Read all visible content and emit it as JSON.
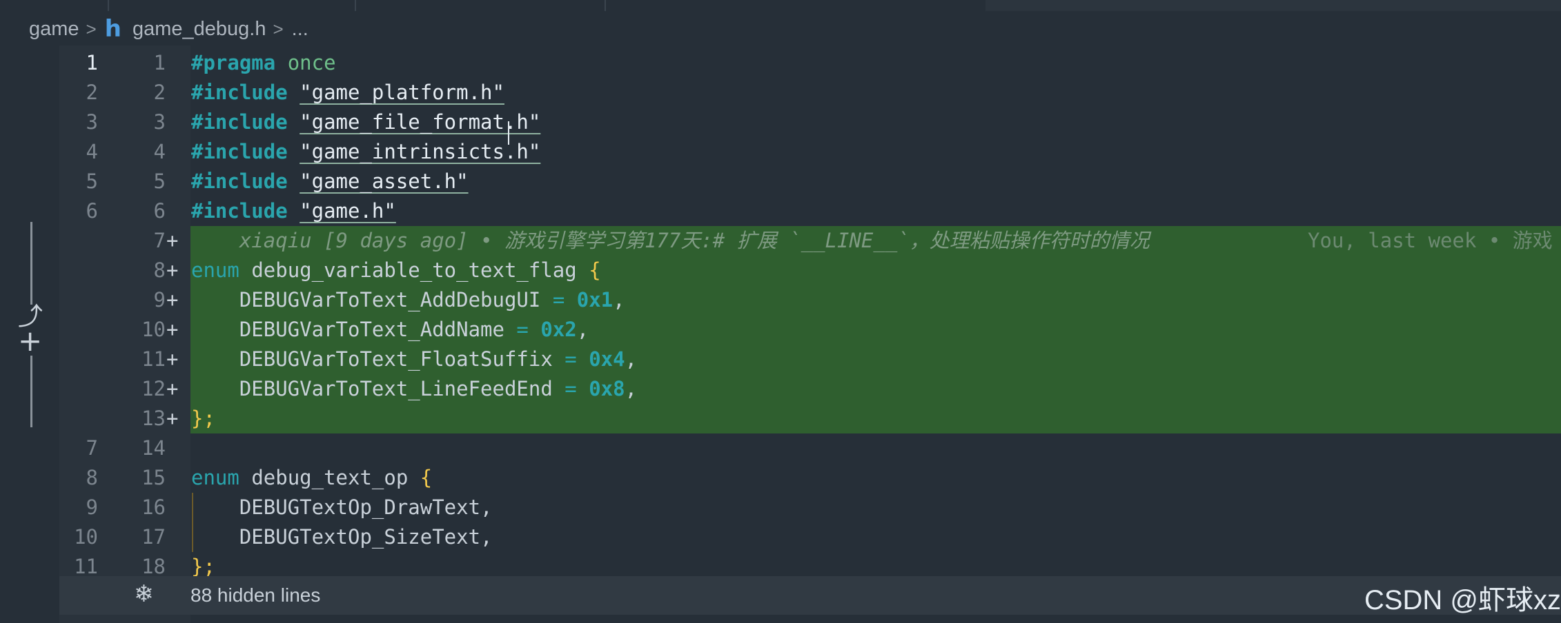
{
  "breadcrumb": {
    "folder": "game",
    "file": "game_debug.h",
    "more": "..."
  },
  "lines": [
    {
      "old": "1",
      "new": "1",
      "plus": "",
      "active": true
    },
    {
      "old": "2",
      "new": "2",
      "plus": ""
    },
    {
      "old": "3",
      "new": "3",
      "plus": ""
    },
    {
      "old": "4",
      "new": "4",
      "plus": ""
    },
    {
      "old": "5",
      "new": "5",
      "plus": ""
    },
    {
      "old": "6",
      "new": "6",
      "plus": ""
    },
    {
      "old": "",
      "new": "7",
      "plus": "+"
    },
    {
      "old": "",
      "new": "8",
      "plus": "+"
    },
    {
      "old": "",
      "new": "9",
      "plus": "+"
    },
    {
      "old": "",
      "new": "10",
      "plus": "+"
    },
    {
      "old": "",
      "new": "11",
      "plus": "+"
    },
    {
      "old": "",
      "new": "12",
      "plus": "+"
    },
    {
      "old": "",
      "new": "13",
      "plus": "+"
    },
    {
      "old": "7",
      "new": "14",
      "plus": ""
    },
    {
      "old": "8",
      "new": "15",
      "plus": ""
    },
    {
      "old": "9",
      "new": "16",
      "plus": ""
    },
    {
      "old": "10",
      "new": "17",
      "plus": ""
    },
    {
      "old": "11",
      "new": "18",
      "plus": ""
    }
  ],
  "code": {
    "pragma_kw": "#pragma",
    "pragma_val": "once",
    "include_kw": "#include",
    "inc1": "\"game_platform.h\"",
    "inc2": "\"game_file_format.h\"",
    "inc3": "\"game_intrinsicts.h\"",
    "inc4": "\"game_asset.h\"",
    "inc5": "\"game.h\"",
    "blame_main": "xiaqiu [9 days ago] • 游戏引擎学习第177天:# 扩展 `__LINE__`，处理粘贴操作符时的情况",
    "blame_side": "You, last week • 游戏",
    "enum_kw": "enum",
    "enum1_name": "debug_variable_to_text_flag",
    "open_brace": "{",
    "close": "};",
    "e1": "DEBUGVarToText_AddDebugUI",
    "e1v": "0x1",
    "e2": "DEBUGVarToText_AddName",
    "e2v": "0x2",
    "e3": "DEBUGVarToText_FloatSuffix",
    "e3v": "0x4",
    "e4": "DEBUGVarToText_LineFeedEnd",
    "e4v": "0x8",
    "enum2_name": "debug_text_op",
    "t1": "DEBUGTextOp_DrawText,",
    "t2": "DEBUGTextOp_SizeText,"
  },
  "hidden": {
    "label": "88 hidden lines"
  },
  "watermark": "CSDN @虾球xz",
  "colors": {
    "background": "#262f38",
    "added_line": "#2f5f2f",
    "keyword": "#2aa5ad",
    "bracket": "#f2c94c"
  }
}
